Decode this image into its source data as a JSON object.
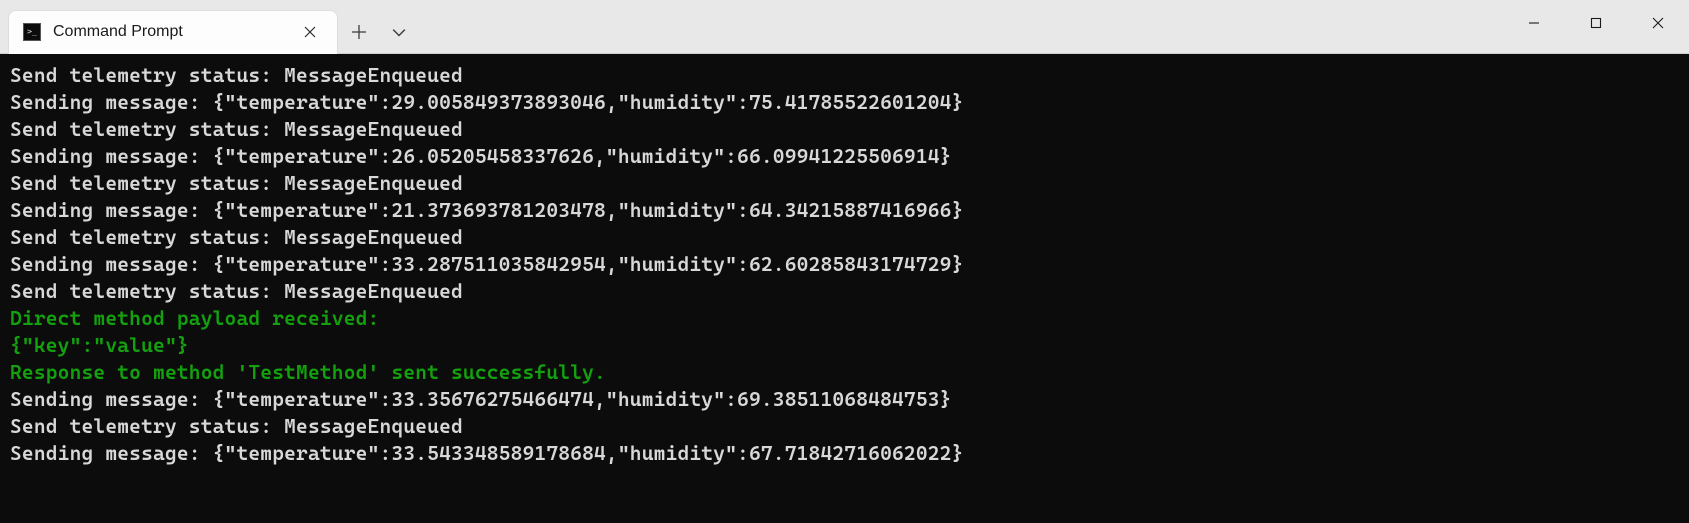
{
  "tabs": [
    {
      "title": "Command Prompt"
    }
  ],
  "terminal": {
    "lines": [
      {
        "text": "Send telemetry status: MessageEnqueued",
        "cls": ""
      },
      {
        "text": "Sending message: {\"temperature\":29.005849373893046,\"humidity\":75.41785522601204}",
        "cls": ""
      },
      {
        "text": "Send telemetry status: MessageEnqueued",
        "cls": ""
      },
      {
        "text": "Sending message: {\"temperature\":26.05205458337626,\"humidity\":66.09941225506914}",
        "cls": ""
      },
      {
        "text": "Send telemetry status: MessageEnqueued",
        "cls": ""
      },
      {
        "text": "Sending message: {\"temperature\":21.373693781203478,\"humidity\":64.34215887416966}",
        "cls": ""
      },
      {
        "text": "Send telemetry status: MessageEnqueued",
        "cls": ""
      },
      {
        "text": "Sending message: {\"temperature\":33.287511035842954,\"humidity\":62.60285843174729}",
        "cls": ""
      },
      {
        "text": "Send telemetry status: MessageEnqueued",
        "cls": ""
      },
      {
        "text": "Direct method payload received:",
        "cls": "green"
      },
      {
        "text": "{\"key\":\"value\"}",
        "cls": "green"
      },
      {
        "text": "Response to method 'TestMethod' sent successfully.",
        "cls": "green"
      },
      {
        "text": "Sending message: {\"temperature\":33.35676275466474,\"humidity\":69.38511068484753}",
        "cls": ""
      },
      {
        "text": "Send telemetry status: MessageEnqueued",
        "cls": ""
      },
      {
        "text": "Sending message: {\"temperature\":33.543348589178684,\"humidity\":67.71842716062022}",
        "cls": ""
      }
    ]
  }
}
